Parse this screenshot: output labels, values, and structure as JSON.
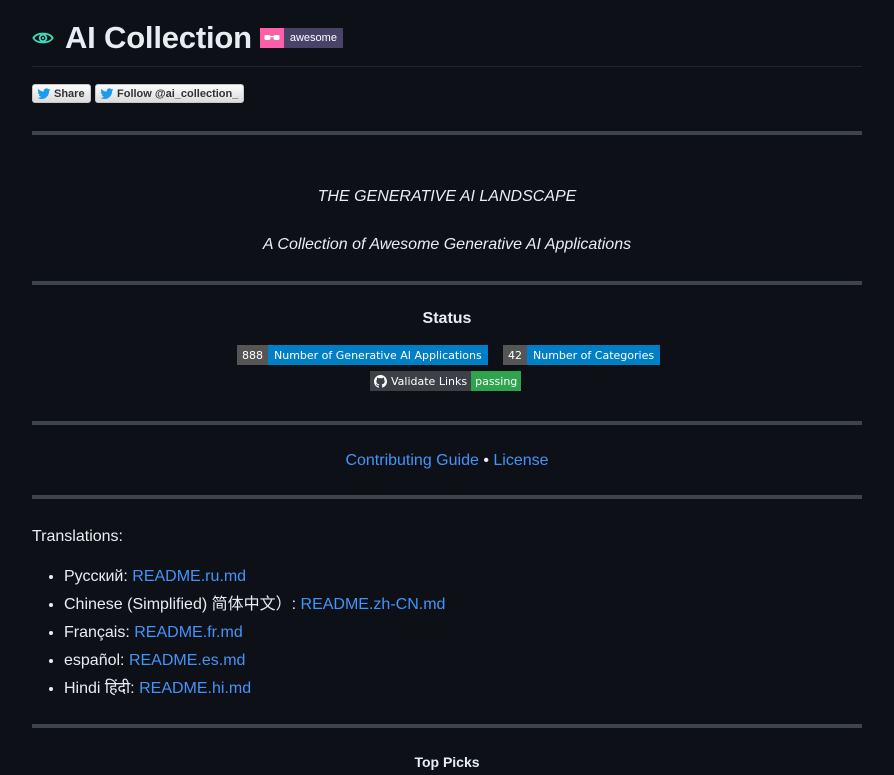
{
  "header": {
    "title": "AI Collection",
    "eye_icon": "eye-icon",
    "awesome_badge": {
      "icon": "sunglasses-icon",
      "label": "awesome"
    }
  },
  "social": {
    "share_label": "Share",
    "follow_label": "Follow @ai_collection_"
  },
  "intro": {
    "landscape": "THE GENERATIVE AI LANDSCAPE",
    "subtitle": "A Collection of Awesome Generative AI Applications"
  },
  "status": {
    "heading": "Status",
    "apps_badge": {
      "count": "888",
      "label": "Number of Generative AI Applications"
    },
    "categories_badge": {
      "count": "42",
      "label": "Number of Categories"
    },
    "validate_badge": {
      "label": "Validate Links",
      "state": "passing"
    }
  },
  "links": {
    "contributing": "Contributing Guide",
    "separator": "•",
    "license": "License"
  },
  "translations": {
    "label": "Translations:",
    "items": [
      {
        "lang": "Русский:",
        "file": "README.ru.md"
      },
      {
        "lang": "Chinese (Simplified) 简体中文）:",
        "file": "README.zh-CN.md"
      },
      {
        "lang": "Français:",
        "file": "README.fr.md"
      },
      {
        "lang": "español:",
        "file": "README.es.md"
      },
      {
        "lang": "Hindi हिंदी:",
        "file": "README.hi.md"
      }
    ]
  },
  "top_picks": {
    "heading": "Top Picks"
  },
  "colors": {
    "background": "#0d1117",
    "link": "#4493f8",
    "shield_blue": "#007ec6",
    "shield_green": "#2ea44f",
    "awesome_pink": "#fc60a8"
  }
}
